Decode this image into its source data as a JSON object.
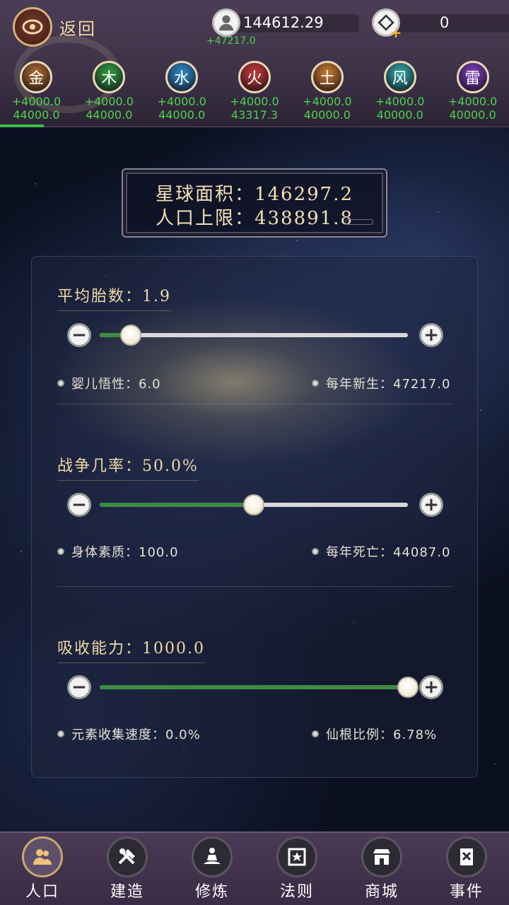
{
  "header": {
    "back_label": "返回",
    "population": "144612.29",
    "population_delta": "+47217.0",
    "coins": "0"
  },
  "elements": [
    {
      "name": "金",
      "gain": "+4000.0",
      "total": "44000.0",
      "color": "#a8682f"
    },
    {
      "name": "木",
      "gain": "+4000.0",
      "total": "44000.0",
      "color": "#2f9a3c"
    },
    {
      "name": "水",
      "gain": "+4000.0",
      "total": "44000.0",
      "color": "#2f86c4"
    },
    {
      "name": "火",
      "gain": "+4000.0",
      "total": "43317.3",
      "color": "#c23838"
    },
    {
      "name": "土",
      "gain": "+4000.0",
      "total": "40000.0",
      "color": "#c4772e"
    },
    {
      "name": "风",
      "gain": "+4000.0",
      "total": "40000.0",
      "color": "#2fa3a0"
    },
    {
      "name": "雷",
      "gain": "+4000.0",
      "total": "40000.0",
      "color": "#7a3bb5"
    }
  ],
  "planet": {
    "area_label": "星球面积：146297.2",
    "limit_label": "人口上限：438891.8"
  },
  "sections": [
    {
      "title": "平均胎数：1.9",
      "level": 0.1,
      "left_stat": "婴儿悟性：6.0",
      "right_stat": "每年新生：47217.0"
    },
    {
      "title": "战争几率：50.0%",
      "level": 0.5,
      "left_stat": "身体素质：100.0",
      "right_stat": "每年死亡：44087.0"
    },
    {
      "title": "吸收能力：1000.0",
      "level": 1.0,
      "left_stat": "元素收集速度：0.0%",
      "right_stat": "仙根比例：6.78%"
    }
  ],
  "slider_buttons": {
    "minus": "−",
    "plus": "+"
  },
  "nav": [
    {
      "label": "人口",
      "icon": "population-icon"
    },
    {
      "label": "建造",
      "icon": "build-icon"
    },
    {
      "label": "修炼",
      "icon": "meditate-icon"
    },
    {
      "label": "法则",
      "icon": "law-icon"
    },
    {
      "label": "商城",
      "icon": "shop-icon"
    },
    {
      "label": "事件",
      "icon": "event-icon"
    }
  ],
  "active_nav": "人口"
}
